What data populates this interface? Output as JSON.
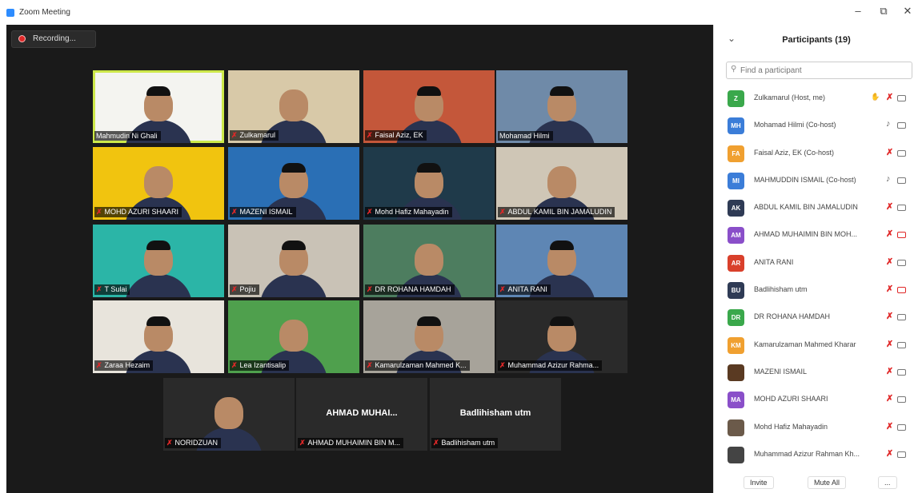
{
  "window": {
    "title": "Zoom Meeting",
    "minimize": "–",
    "restore": "⧉",
    "close": "✕"
  },
  "recording": {
    "label": "Recording..."
  },
  "grid": [
    {
      "name": "Mahmudin Ni Ghali",
      "muted": false,
      "bigname": ""
    },
    {
      "name": "Zulkamarul",
      "muted": true,
      "bigname": ""
    },
    {
      "name": "Faisal Aziz, EK",
      "muted": true,
      "bigname": ""
    },
    {
      "name": "Mohamad Hilmi",
      "muted": false,
      "bigname": ""
    },
    {
      "name": "MOHD AZURI SHAARI",
      "muted": true,
      "bigname": ""
    },
    {
      "name": "MAZENI ISMAIL",
      "muted": true,
      "bigname": ""
    },
    {
      "name": "Mohd Hafiz Mahayadin",
      "muted": true,
      "bigname": ""
    },
    {
      "name": "ABDUL KAMIL BIN JAMALUDIN",
      "muted": true,
      "bigname": ""
    },
    {
      "name": "T Sulai",
      "muted": true,
      "bigname": ""
    },
    {
      "name": "Pojiu",
      "muted": true,
      "bigname": ""
    },
    {
      "name": "DR ROHANA HAMDAH",
      "muted": true,
      "bigname": ""
    },
    {
      "name": "ANITA RANI",
      "muted": true,
      "bigname": ""
    },
    {
      "name": "Zaraa Hezaim",
      "muted": true,
      "bigname": ""
    },
    {
      "name": "Lea Izantisalip",
      "muted": true,
      "bigname": ""
    },
    {
      "name": "Kamarulzaman Mahmed K...",
      "muted": true,
      "bigname": ""
    },
    {
      "name": "Muhammad Azizur Rahma...",
      "muted": true,
      "bigname": ""
    },
    {
      "name": "NORIDZUAN",
      "muted": true,
      "bigname": ""
    },
    {
      "name": "AHMAD MUHAIMIN BIN M...",
      "muted": true,
      "bigname": "AHMAD MUHAI..."
    },
    {
      "name": "Badlihisham utm",
      "muted": true,
      "bigname": "Badlihisham utm"
    }
  ],
  "panel": {
    "title": "Participants (19)",
    "collapse": "⌄",
    "search_placeholder": "Find a participant",
    "participants": [
      {
        "initials": "Z",
        "color": "#3aa84b",
        "name": "Zulkamarul (Host, me)",
        "hand": "✋",
        "mic_muted": true,
        "cam_off": false
      },
      {
        "initials": "MH",
        "color": "#3b7dd8",
        "name": "Mohamad Hilmi (Co-host)",
        "hand": "",
        "mic_muted": false,
        "cam_off": false
      },
      {
        "initials": "FA",
        "color": "#f0a030",
        "name": "Faisal Aziz, EK (Co-host)",
        "hand": "",
        "mic_muted": true,
        "cam_off": false
      },
      {
        "initials": "MI",
        "color": "#3b7dd8",
        "name": "MAHMUDDIN ISMAIL (Co-host)",
        "hand": "",
        "mic_muted": false,
        "cam_off": false
      },
      {
        "initials": "AK",
        "color": "#2f3b55",
        "name": "ABDUL KAMIL BIN JAMALUDIN",
        "hand": "",
        "mic_muted": true,
        "cam_off": false
      },
      {
        "initials": "AM",
        "color": "#8a4fc9",
        "name": "AHMAD MUHAIMIN BIN MOH...",
        "hand": "",
        "mic_muted": true,
        "cam_off": true
      },
      {
        "initials": "AR",
        "color": "#d9402b",
        "name": "ANITA RANI",
        "hand": "",
        "mic_muted": true,
        "cam_off": false
      },
      {
        "initials": "BU",
        "color": "#2f3b55",
        "name": "Badlihisham utm",
        "hand": "",
        "mic_muted": true,
        "cam_off": true
      },
      {
        "initials": "DR",
        "color": "#3aa84b",
        "name": "DR ROHANA HAMDAH",
        "hand": "",
        "mic_muted": true,
        "cam_off": false
      },
      {
        "initials": "KM",
        "color": "#f0a030",
        "name": "Kamarulzaman Mahmed Kharar",
        "hand": "",
        "mic_muted": true,
        "cam_off": false
      },
      {
        "initials": "",
        "color": "#5a3a22",
        "name": "MAZENI ISMAIL",
        "hand": "",
        "mic_muted": true,
        "cam_off": false
      },
      {
        "initials": "MA",
        "color": "#8a4fc9",
        "name": "MOHD AZURI SHAARI",
        "hand": "",
        "mic_muted": true,
        "cam_off": false
      },
      {
        "initials": "",
        "color": "#6b5a4a",
        "name": "Mohd Hafiz Mahayadin",
        "hand": "",
        "mic_muted": true,
        "cam_off": false
      },
      {
        "initials": "",
        "color": "#444444",
        "name": "Muhammad Azizur Rahman Kh...",
        "hand": "",
        "mic_muted": true,
        "cam_off": false
      }
    ],
    "invite": "Invite",
    "mute_all": "Mute All",
    "more": "..."
  }
}
